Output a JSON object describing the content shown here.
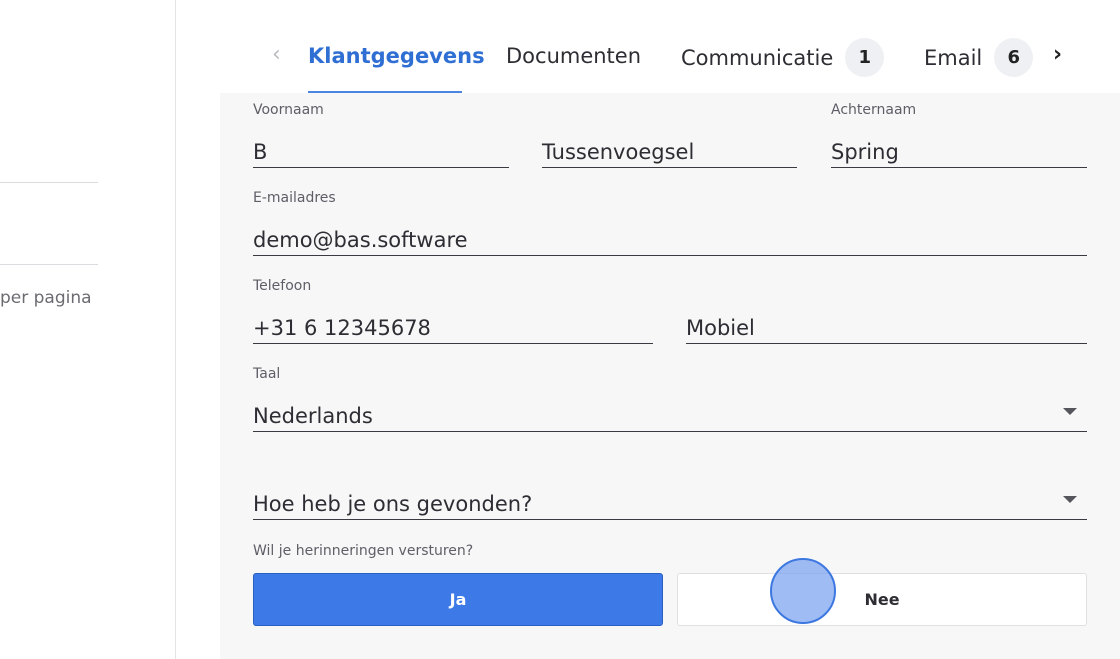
{
  "left_panel": {
    "per_page_text": "per pagina"
  },
  "tabs": {
    "prev_icon": "chevron-left-icon",
    "next_icon": "chevron-right-icon",
    "items": [
      {
        "label": "Klantgegevens",
        "active": true
      },
      {
        "label": "Documenten"
      },
      {
        "label": "Communicatie",
        "badge": "1"
      },
      {
        "label": "Email",
        "badge": "6"
      }
    ]
  },
  "form": {
    "voornaam": {
      "label": "Voornaam",
      "value": "B"
    },
    "tussenvoegsel": {
      "placeholder": "Tussenvoegsel"
    },
    "achternaam": {
      "label": "Achternaam",
      "value": "Spring"
    },
    "email": {
      "label": "E-mailadres",
      "value": "demo@bas.software"
    },
    "telefoon": {
      "label": "Telefoon",
      "value": "+31 6 12345678"
    },
    "mobiel": {
      "placeholder": "Mobiel"
    },
    "taal": {
      "label": "Taal",
      "value": "Nederlands"
    },
    "gevonden": {
      "placeholder": "Hoe heb je ons gevonden?"
    },
    "herinneringen": {
      "label": "Wil je herinneringen versturen?",
      "yes": "Ja",
      "no": "Nee"
    }
  },
  "colors": {
    "accent": "#3d7ae8",
    "active_tab": "#2f6fd4",
    "form_bg": "#f7f7f8"
  }
}
